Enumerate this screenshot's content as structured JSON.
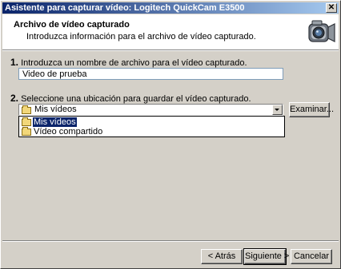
{
  "window": {
    "title": "Asistente para capturar vídeo: Logitech QuickCam E3500",
    "close_glyph": "✕"
  },
  "header": {
    "title": "Archivo de vídeo capturado",
    "subtitle": "Introduzca información para el archivo de vídeo capturado.",
    "icon": "camera-icon"
  },
  "step1": {
    "number": "1.",
    "label": "Introduzca un nombre de archivo para el vídeo capturado.",
    "filename_value": "Video de prueba"
  },
  "step2": {
    "number": "2.",
    "label": "Seleccione una ubicación para guardar el vídeo capturado.",
    "location_selected": "Mis vídeos",
    "location_options": [
      "Mis vídeos",
      "Vídeo compartido"
    ],
    "browse_label": "Examinar..."
  },
  "footer": {
    "back_label": "< Atrás",
    "next_label": "Siguiente >",
    "cancel_label": "Cancelar"
  },
  "colors": {
    "titlebar": "#0a246a",
    "selection": "#0a246a",
    "face": "#d4d0c8"
  }
}
